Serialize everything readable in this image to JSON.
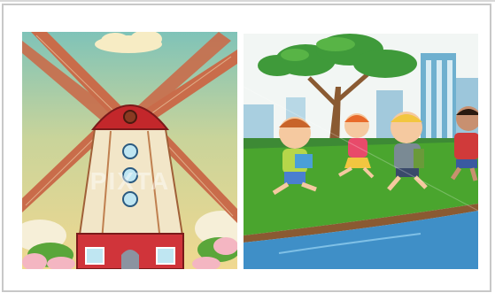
{
  "images": [
    {
      "subject": "windmill",
      "watermark": "PIXTA"
    },
    {
      "subject": "children-running-in-park"
    }
  ],
  "colors": {
    "sky_warm": "#e8d79a",
    "sky_teal": "#8fc9bd",
    "roof_red": "#c3272b",
    "grass_green": "#4aa52e",
    "water_blue": "#3f8fc7"
  }
}
